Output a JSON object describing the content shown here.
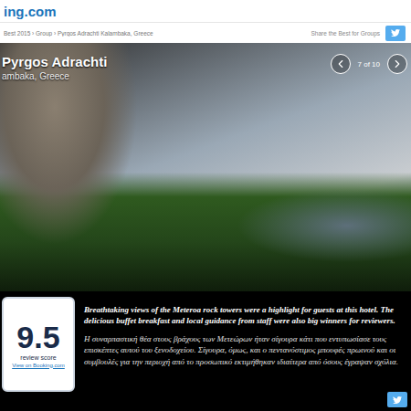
{
  "header": {
    "logo": "ing.com"
  },
  "breadcrumb": {
    "path": "Best 2015 › Group › Pyrgos Adrachti Kalambaka, Greece",
    "share_label": "Share the Best for Groups"
  },
  "slide": {
    "title": "Pyrgos Adrachti",
    "location": "ambaka, Greece",
    "counter": "7 of 10"
  },
  "score": {
    "value": "9.5",
    "label": "review score",
    "link": "View on Booking.com"
  },
  "description": {
    "english": "Breathtaking views of the Meteroa rock towers were a highlight for guests at this hotel. The delicious buffet breakfast and local guidance from staff were also big winners for reviewers.",
    "greek": "Η συναρπαστική θέα στους βράχους των Μετεώρων ήταν σίγουρα κάτι που εντυπωσίασε τους επισκέπτες αυτού του ξενοδοχείου. Σίγουρα, όμως, και ο πεντανόστιμος μπουφές πρωινού και οι συμβουλές για την περιοχή από το προσωπικό εκτιμήθηκαν ιδιαίτερα από όσους έγραψαν σχόλια."
  }
}
